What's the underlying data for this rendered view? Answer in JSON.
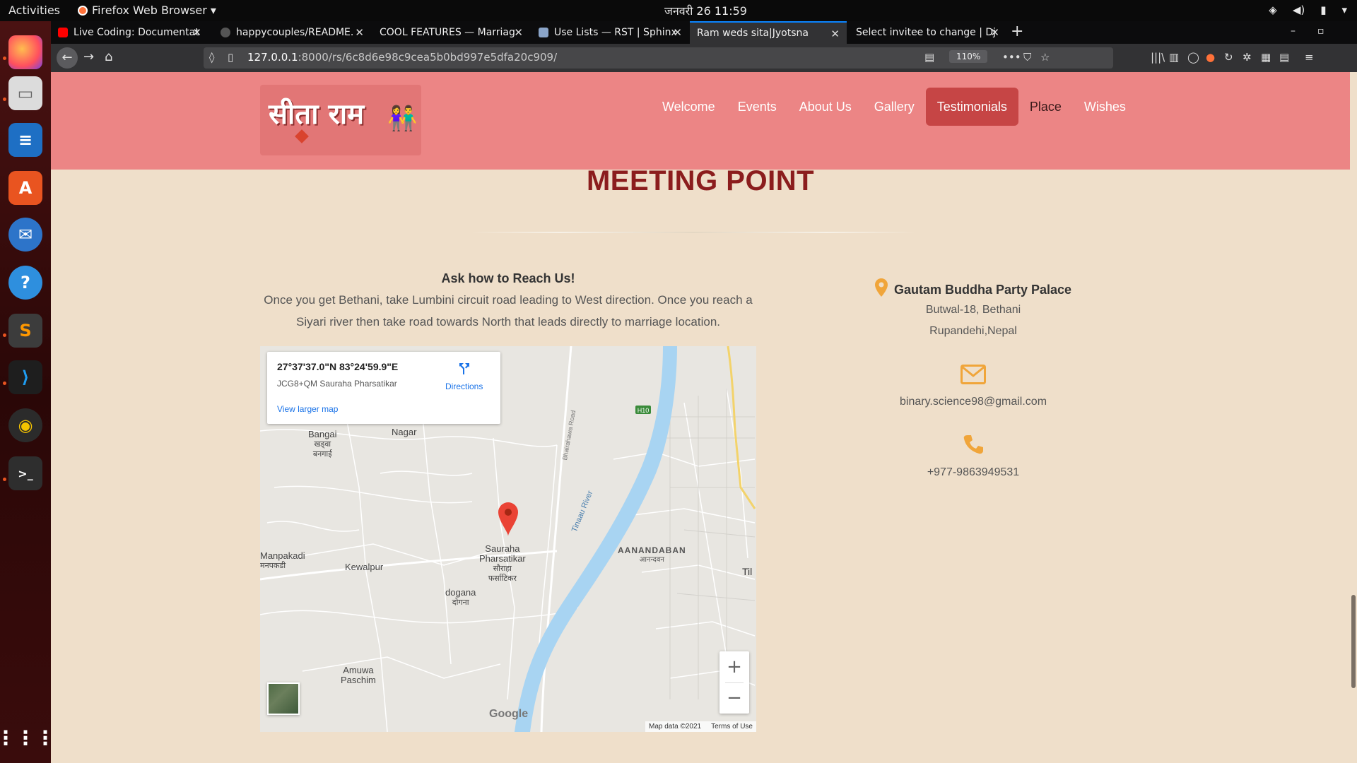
{
  "os": {
    "activities": "Activities",
    "app_name": "Firefox Web Browser ▾",
    "clock": "जनवरी 26  11:59"
  },
  "browser": {
    "tabs": [
      {
        "title": "Live Coding: Documentat",
        "color": "#ff0000"
      },
      {
        "title": "happycouples/README.",
        "color": "#444444"
      },
      {
        "title": "COOL FEATURES — Marriag",
        "color": "#0c0c0d"
      },
      {
        "title": "Use Lists — RST | Sphinx",
        "color": "#8aa4c8"
      },
      {
        "title": "Ram weds sita|Jyotsna",
        "color": "#323234"
      },
      {
        "title": "Select invitee to change | Dj",
        "color": "#0c0c0d"
      }
    ],
    "url_host": "127.0.0.1",
    "url_rest": ":8000/rs/6c8d6e98c9cea5b0bd997e5dfa20c909/",
    "zoom": "110%"
  },
  "site": {
    "logo_text": "सीता राम",
    "nav": [
      "Welcome",
      "Events",
      "About Us",
      "Gallery",
      "Testimonials",
      "Place",
      "Wishes"
    ],
    "active_nav": "Testimonials",
    "colors": {
      "header": "#ec8585",
      "active_nav": "#c64545",
      "title": "#8b1d1d",
      "page_bg": "#efdfca",
      "accent_icon": "#f0a53a"
    }
  },
  "section": {
    "title": "MEETING POINT",
    "reach_heading": "Ask how to Reach Us!",
    "reach_text": "Once you get Bethani, take Lumbini circuit road leading to West direction. Once you reach a Siyari river then take road towards North that leads directly to marriage location."
  },
  "map": {
    "coords": "27°37'37.0\"N 83°24'59.9\"E",
    "plus_code": "JCG8+QM Sauraha Pharsatikar",
    "view_larger": "View larger map",
    "directions": "Directions",
    "labels": {
      "bangai": "Bangai",
      "bangai_dev": "खड्वा",
      "bangai_dev2": "बनगाई",
      "nagar": "Nagar",
      "sauraha": "Sauraha",
      "sauraha2": "Pharsatikar",
      "sauraha_dev": "सौराहा",
      "sauraha_dev2": "फर्साटिकर",
      "manpakadi": "Manpakadi",
      "manpakadi_dev": "मनपकडी",
      "kewalpur": "Kewalpur",
      "dogana": "dogana",
      "dogana_dev": "दोगना",
      "aanandaban": "AANANDABAN",
      "aanandaban_dev": "आनन्दवन",
      "amuwa": "Amuwa",
      "amuwa2": "Paschim",
      "river": "Tinaau River",
      "road": "Bhairahawa Road",
      "hwy": "H10",
      "tili": "Til"
    },
    "google": "Google",
    "map_data": "Map data ©2021",
    "terms": "Terms of Use"
  },
  "contact": {
    "venue": "Gautam Buddha Party Palace",
    "address_line1": "Butwal-18, Bethani",
    "address_line2": "Rupandehi,Nepal",
    "email": "binary.science98@gmail.com",
    "phone": "+977-9863949531"
  }
}
